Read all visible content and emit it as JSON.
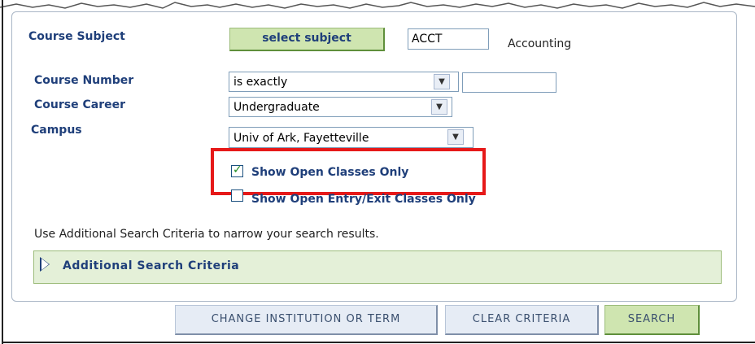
{
  "subject": {
    "label": "Course Subject",
    "button_label": "select subject",
    "value": "ACCT",
    "description": "Accounting"
  },
  "course_number": {
    "label": "Course Number",
    "operator": "is exactly",
    "value": ""
  },
  "course_career": {
    "label": "Course Career",
    "value": "Undergraduate"
  },
  "campus": {
    "label": "Campus",
    "value": "Univ of Ark, Fayetteville"
  },
  "open_classes": {
    "label": "Show Open Classes Only",
    "checked": true
  },
  "open_entry": {
    "label": "Show Open Entry/Exit Classes Only",
    "checked": false
  },
  "hint_text": "Use Additional Search Criteria to narrow your search results.",
  "additional_criteria": {
    "label": "Additional Search Criteria"
  },
  "buttons": {
    "change_institution": "Change Institution or Term",
    "clear_criteria": "Clear Criteria",
    "search": "Search"
  },
  "colors": {
    "label_blue": "#1f3f7a",
    "green_button": "#cfe5b0",
    "highlight_red": "#e61919"
  }
}
